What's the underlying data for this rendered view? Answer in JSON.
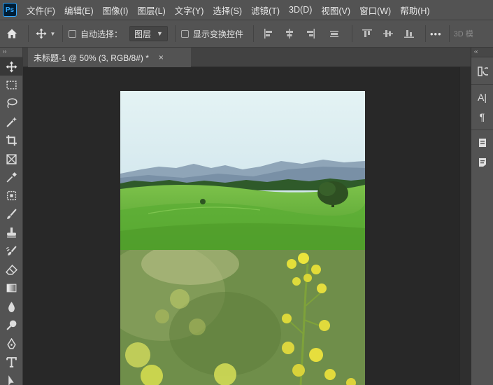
{
  "app": {
    "logo_text": "Ps",
    "menu": [
      "文件(F)",
      "编辑(E)",
      "图像(I)",
      "图层(L)",
      "文字(Y)",
      "选择(S)",
      "滤镜(T)",
      "3D(D)",
      "视图(V)",
      "窗口(W)",
      "帮助(H)"
    ]
  },
  "options": {
    "auto_select_label": "自动选择：",
    "auto_select_value": "图层",
    "show_transform_label": "显示变换控件",
    "more_label": "•••",
    "mode_3d_label": "3D 模"
  },
  "document": {
    "tab_title": "未标题-1 @ 50% (3, RGB/8#) *",
    "close_glyph": "×"
  },
  "toolbar": {
    "collapse_glyph": "››",
    "tools": [
      "move-tool",
      "marquee-tool",
      "lasso-tool",
      "magic-wand-tool",
      "crop-tool",
      "frame-tool",
      "eyedropper-tool",
      "healing-tool",
      "brush-tool",
      "clone-stamp-tool",
      "history-brush-tool",
      "eraser-tool",
      "gradient-tool",
      "blur-tool",
      "dodge-tool",
      "pen-tool",
      "type-tool",
      "path-selection-tool"
    ]
  },
  "right_panel": {
    "collapse_glyph": "‹‹",
    "type_glyph": "A|",
    "paragraph_glyph": "¶"
  }
}
